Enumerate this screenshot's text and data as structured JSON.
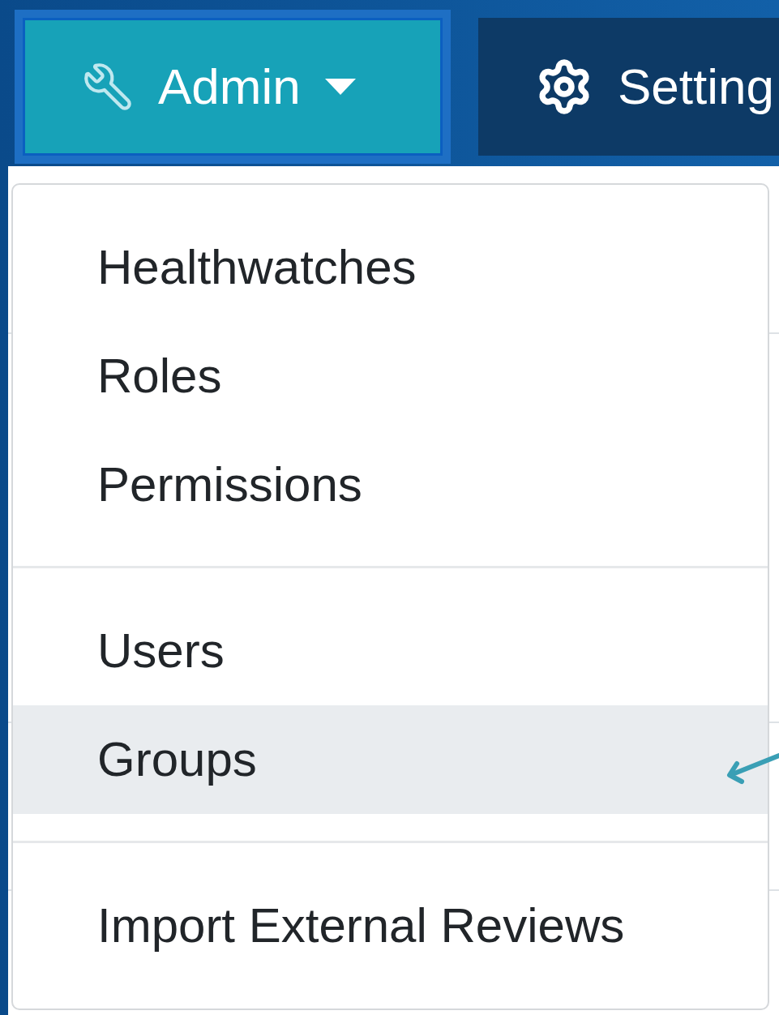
{
  "navbar": {
    "buttons": [
      {
        "label": "Admin",
        "kind": "wrench",
        "selected": true,
        "caret": true
      },
      {
        "label": "Setting",
        "kind": "gears",
        "selected": false
      }
    ]
  },
  "dropdown": {
    "groups": [
      [
        {
          "label": "Healthwatches",
          "highlighted": false
        },
        {
          "label": "Roles",
          "highlighted": false
        },
        {
          "label": "Permissions",
          "highlighted": false
        }
      ],
      [
        {
          "label": "Users",
          "highlighted": false
        },
        {
          "label": "Groups",
          "highlighted": true
        }
      ],
      [
        {
          "label": "Import External Reviews",
          "highlighted": false
        }
      ]
    ]
  },
  "annotation": {
    "kind": "arrow",
    "color": "#3a9fb5"
  }
}
